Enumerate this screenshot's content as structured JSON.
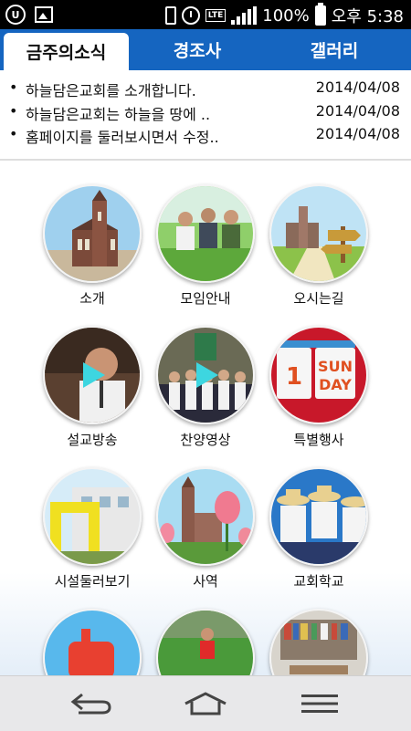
{
  "status_bar": {
    "battery": "100%",
    "time": "오후 5:38",
    "network": "LTE",
    "left_icons": [
      "u-plus-icon",
      "gallery-icon"
    ],
    "right_icons": [
      "vibrate-icon",
      "alarm-icon",
      "lte-icon",
      "signal-icon",
      "battery-icon"
    ]
  },
  "tabs": [
    {
      "label": "금주의소식",
      "active": true
    },
    {
      "label": "경조사",
      "active": false
    },
    {
      "label": "갤러리",
      "active": false
    }
  ],
  "news": [
    {
      "title": "하늘담은교회를 소개합니다.",
      "date": "2014/04/08"
    },
    {
      "title": "하늘담은교회는 하늘을 땅에 ..",
      "date": "2014/04/08"
    },
    {
      "title": "홈페이지를 둘러보시면서 수정..",
      "date": "2014/04/08"
    }
  ],
  "menu": [
    {
      "label": "소개"
    },
    {
      "label": "모임안내"
    },
    {
      "label": "오시는길"
    },
    {
      "label": "설교방송"
    },
    {
      "label": "찬양영상"
    },
    {
      "label": "특별행사"
    },
    {
      "label": "시설둘러보기"
    },
    {
      "label": "사역"
    },
    {
      "label": "교회학교"
    },
    {
      "label": ""
    },
    {
      "label": ""
    },
    {
      "label": ""
    }
  ],
  "calendar_icon": {
    "num": "1",
    "word1": "SUN",
    "word2": "DAY"
  },
  "colors": {
    "accent": "#1565c0",
    "play": "#3dd6e0"
  },
  "nav": [
    {
      "icon": "back-icon"
    },
    {
      "icon": "home-icon"
    },
    {
      "icon": "menu-icon"
    }
  ]
}
